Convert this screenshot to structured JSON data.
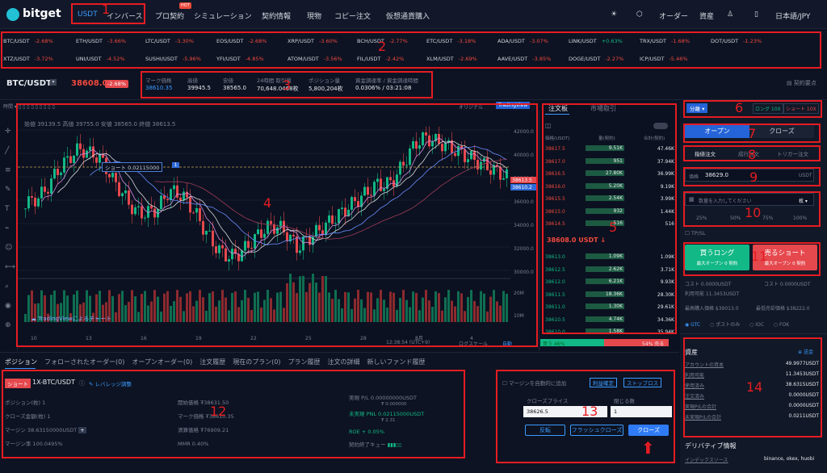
{
  "nav": {
    "brand": "bitget",
    "usdt": "USDT",
    "inverse": "インバース",
    "pro": "プロ契約",
    "hot": "HOT",
    "sim": "シミュレーション",
    "contract": "契約情報",
    "spot": "現物",
    "copy": "コピー注文",
    "crypto": "仮想通貨購入",
    "order": "オーダー",
    "assets": "資産",
    "lang": "日本語/JPY"
  },
  "ticker": [
    {
      "s": "BTC/USDT",
      "p": "-2.68%",
      "up": false
    },
    {
      "s": "ETH/USDT",
      "p": "-3.66%",
      "up": false
    },
    {
      "s": "LTC/USDT",
      "p": "-3.30%",
      "up": false
    },
    {
      "s": "EOS/USDT",
      "p": "-2.68%",
      "up": false
    },
    {
      "s": "XRP/USDT",
      "p": "-3.60%",
      "up": false
    },
    {
      "s": "BCH/USDT",
      "p": "-2.77%",
      "up": false
    },
    {
      "s": "ETC/USDT",
      "p": "-3.18%",
      "up": false
    },
    {
      "s": "ADA/USDT",
      "p": "-3.07%",
      "up": false
    },
    {
      "s": "LINK/USDT",
      "p": "+0.63%",
      "up": true
    },
    {
      "s": "TRX/USDT",
      "p": "-1.68%",
      "up": false
    },
    {
      "s": "DOT/USDT",
      "p": "-1.23%",
      "up": false
    },
    {
      "s": "XTZ/USDT",
      "p": "-3.72%",
      "up": false
    },
    {
      "s": "UNI/USDT",
      "p": "-4.52%",
      "up": false
    },
    {
      "s": "SUSHI/USDT",
      "p": "-5.96%",
      "up": false
    },
    {
      "s": "YFI/USDT",
      "p": "-4.85%",
      "up": false
    },
    {
      "s": "ATOM/USDT",
      "p": "-3.56%",
      "up": false
    },
    {
      "s": "FIL/USDT",
      "p": "-2.42%",
      "up": false
    },
    {
      "s": "XLM/USDT",
      "p": "-2.69%",
      "up": false
    },
    {
      "s": "AAVE/USDT",
      "p": "-3.85%",
      "up": false
    },
    {
      "s": "DOGE/USDT",
      "p": "-2.27%",
      "up": false
    },
    {
      "s": "ICP/USDT",
      "p": "-5.46%",
      "up": false
    }
  ],
  "pair": {
    "name": "BTC/USDT",
    "price": "38608.0",
    "change": "-2.68%",
    "mark_label": "マーク価格",
    "mark": "38610.35",
    "high_label": "高値",
    "high": "39945.5",
    "low_label": "安値",
    "low": "38565.0",
    "vol_label": "24時間 取引量",
    "vol": "70,648.0468枚",
    "pos_label": "ポジション量",
    "pos": "5,800,204枚",
    "fund_label": "資金調達率 / 資金調達時間",
    "fund": "0.0306% / 03:21:08",
    "contract_info": "契約要点"
  },
  "chart": {
    "ohlc": "始値 39139.5 高値 39755.0 安値 38565.0 終値 38613.5",
    "short_label": "ショート 0.02115000",
    "watermark": "TradingViewによるチャート",
    "original": "オリジナル",
    "tv": "TradingView",
    "prices": [
      "42000.0",
      "40000.0",
      "38000.0",
      "36000.0",
      "34000.0",
      "32000.0",
      "30000.0"
    ],
    "tags": [
      "38613.5",
      "38610.2"
    ],
    "dates": [
      "10",
      "13",
      "16",
      "19",
      "22",
      "25",
      "28",
      "8月",
      "4"
    ],
    "time": "12:38:54 (UTC+9)",
    "log": "ログスケール",
    "auto": "自動",
    "vol_ticks": [
      "20M",
      "10M"
    ]
  },
  "ob": {
    "tab1": "注文板",
    "tab2": "市場取引",
    "h_price": "価格(USDT)",
    "h_qty": "量(契約)",
    "h_total": "合計(契約)",
    "asks": [
      [
        "38617.5",
        "9.51K",
        "47.46K"
      ],
      [
        "38617.0",
        "951",
        "37.94K"
      ],
      [
        "38616.5",
        "27.80K",
        "36.99K"
      ],
      [
        "38616.0",
        "5.20K",
        "9.19K"
      ],
      [
        "38615.5",
        "2.54K",
        "3.99K"
      ],
      [
        "38615.0",
        "932",
        "1.44K"
      ],
      [
        "38614.5",
        "516",
        "516"
      ]
    ],
    "mid": "38608.0 USDT ↓",
    "bids": [
      [
        "38613.0",
        "1.09K",
        "1.09K"
      ],
      [
        "38612.5",
        "2.62K",
        "3.71K"
      ],
      [
        "38612.0",
        "6.21K",
        "9.93K"
      ],
      [
        "38611.5",
        "18.36K",
        "28.30K"
      ],
      [
        "38611.0",
        "1.30K",
        "29.61K"
      ],
      [
        "38610.5",
        "4.74K",
        "34.36K"
      ],
      [
        "38610.0",
        "1.58K",
        "35.94K"
      ]
    ],
    "buy": "買う",
    "buy_pct": "46%",
    "sell_pct": "54%",
    "sell": "売る"
  },
  "tp": {
    "mode": "分離",
    "long": "ロング 10X",
    "short": "ショート 10X",
    "open": "オープン",
    "close": "クローズ",
    "limit": "指値注文",
    "market": "成行注文",
    "trigger": "トリガー注文",
    "price_label": "価格",
    "price": "38629.0",
    "unit": "USDT",
    "qty_ph": "数量を入力してください",
    "qty_unit": "枚",
    "p25": "25%",
    "p50": "50%",
    "p75": "75%",
    "p100": "100%",
    "tpsl": "TP/SL",
    "buy_long": "買うロング",
    "buy_long_sub": "最大オープン 0 契約",
    "sell_short": "売るショート",
    "sell_short_sub": "最大オープン 0 契約",
    "cost_l": "コスト 0.0000USDT",
    "cost_r": "コスト 0.0000USDT",
    "avail": "利用可能 11.3453USDT",
    "max_buy": "最高購入価格 $39013.0",
    "min_sell": "最低売却価格 $38222.0",
    "gtc": "GTC",
    "post": "ポストのみ",
    "ioc": "IOC",
    "fok": "FOK",
    "assets_title": "資産",
    "transfer": "送金",
    "assets": [
      [
        "アカウントの資本",
        "49.9977USDT"
      ],
      [
        "利用可能",
        "11.3453USDT"
      ],
      [
        "使用済み",
        "38.6315USDT"
      ],
      [
        "注文済み",
        "0.0000USDT"
      ],
      [
        "実現P/Lの合計",
        "0.0000USDT"
      ],
      [
        "未実現P/Lの合計",
        "0.0211USDT"
      ]
    ],
    "deriv_title": "デリバティブ情報",
    "index": "インデックスソース",
    "index_val": "binance, okex, huobi"
  },
  "bottom": {
    "tabs": [
      "ポジション",
      "フォローされたオーダー(0)",
      "オープンオーダー(0)",
      "注文履歴",
      "現在のプラン(0)",
      "プラン履歴",
      "注文の詳細",
      "新しいファンド履歴"
    ],
    "side": "ショート",
    "pair": "1X-BTC/USDT",
    "leverage": "レバレッジ調整",
    "l1": "ポジション(枚) 1",
    "l2": "クローズ金額(枚) 1",
    "l3": "マージン 38.63150000USDT",
    "l4": "マージン率 100.0495%",
    "m1": "開始価格 ₮38631.50",
    "m2": "マーク価格 ₮38610.35",
    "m3": "清算価格 ₮76909.21",
    "m4": "MMR 0.40%",
    "r1": "実現 P/L 0.00000000USDT",
    "r1b": "₮ 0.000000",
    "r2": "未実現 PNL 0.02115000USDT",
    "r2b": "₮ 2.31",
    "r3": "ROE + 0.05%",
    "r4": "契約終了キュー",
    "auto_margin": "マージンを自動的に追加",
    "take_profit": "利益確定",
    "stop_loss": "ストップロス",
    "close_price": "クローズプライス",
    "close_qty": "閉じる数",
    "close_price_val": "38626.5",
    "close_qty_val": "1",
    "reverse": "反転",
    "flash": "フラッシュクローズ",
    "close_btn": "クローズ"
  },
  "annotations": [
    "1",
    "2",
    "3",
    "4",
    "5",
    "6",
    "7",
    "8",
    "9",
    "10",
    "11",
    "12",
    "13",
    "14"
  ]
}
